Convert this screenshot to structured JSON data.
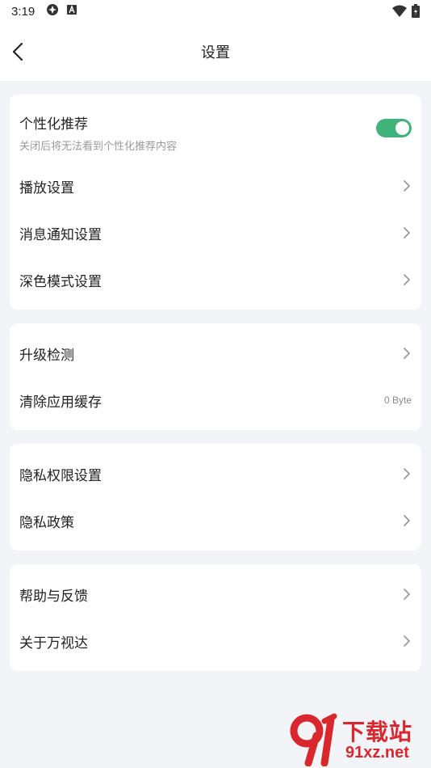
{
  "status_bar": {
    "time": "3:19"
  },
  "header": {
    "title": "设置"
  },
  "sections": [
    {
      "items": [
        {
          "label": "个性化推荐",
          "sub": "关闭后将无法看到个性化推荐内容",
          "toggle_on": true
        },
        {
          "label": "播放设置"
        },
        {
          "label": "消息通知设置"
        },
        {
          "label": "深色模式设置"
        }
      ]
    },
    {
      "items": [
        {
          "label": "升级检测"
        },
        {
          "label": "清除应用缓存",
          "value": "0 Byte"
        }
      ]
    },
    {
      "items": [
        {
          "label": "隐私权限设置"
        },
        {
          "label": "隐私政策"
        }
      ]
    },
    {
      "items": [
        {
          "label": "帮助与反馈"
        },
        {
          "label": "关于万视达"
        }
      ]
    }
  ],
  "watermark": {
    "top_text": "下载站",
    "bottom_text": "91xz.net"
  },
  "colors": {
    "toggle_on": "#3fb37a",
    "background": "#f3f4f8",
    "watermark": "#d9272e"
  }
}
